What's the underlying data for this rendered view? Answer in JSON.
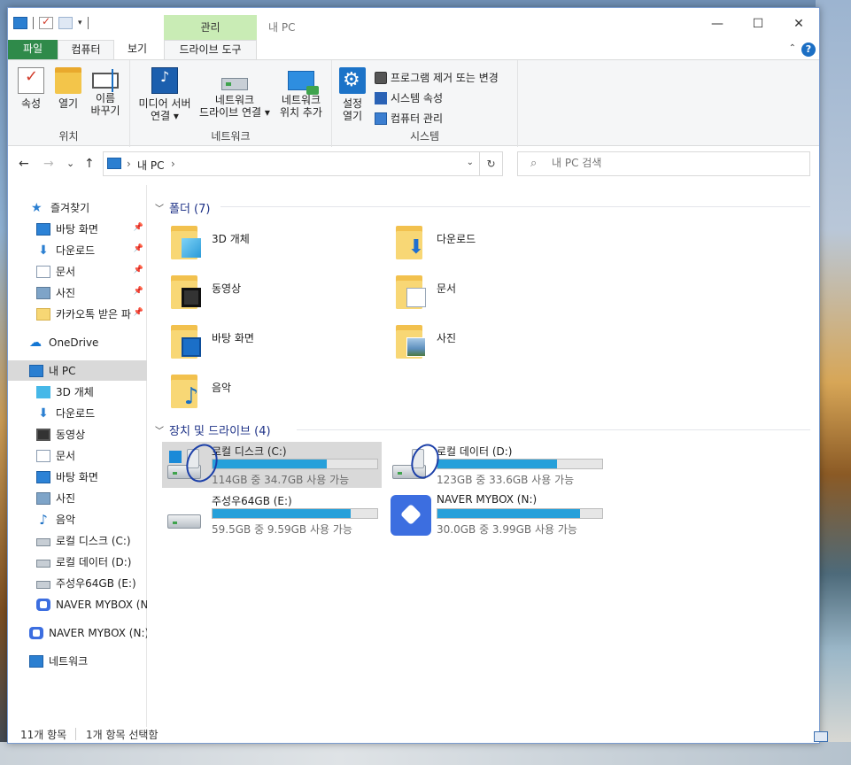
{
  "window": {
    "title": "내 PC",
    "contextual_tab": "관리",
    "controls": {
      "minimize": "—",
      "maximize": "☐",
      "close": "✕"
    }
  },
  "tabs": {
    "file": "파일",
    "computer": "컴퓨터",
    "view": "보기",
    "drive_tools": "드라이브 도구",
    "collapse": "⌃",
    "help": "?"
  },
  "ribbon": {
    "location": {
      "title": "위치",
      "properties": "속성",
      "open": "열기",
      "rename": "이름\n바꾸기"
    },
    "network": {
      "title": "네트워크",
      "media_server": "미디어 서버\n연결 ▾",
      "network_drive": "네트워크\n드라이브 연결 ▾",
      "network_location": "네트워크\n위치 추가"
    },
    "system": {
      "title": "시스템",
      "settings": "설정\n열기",
      "uninstall": "프로그램 제거 또는 변경",
      "sys_props": "시스템 속성",
      "manage": "컴퓨터 관리"
    }
  },
  "nav": {
    "back": "←",
    "forward": "→",
    "recent": "⌄",
    "up": "↑",
    "breadcrumb": [
      "내 PC"
    ],
    "crumb_sep": "›",
    "dropdown": "⌄",
    "refresh": "↻",
    "search_placeholder": "내 PC 검색",
    "search_icon": "⌕"
  },
  "navpane": {
    "quick_access": "즐겨찾기",
    "quick_items": [
      {
        "label": "바탕 화면",
        "icon": "desktop-icon",
        "pinned": true
      },
      {
        "label": "다운로드",
        "icon": "download-icon",
        "pinned": true
      },
      {
        "label": "문서",
        "icon": "document-icon",
        "pinned": true
      },
      {
        "label": "사진",
        "icon": "picture-icon",
        "pinned": true
      },
      {
        "label": "카카오톡 받은 파",
        "icon": "folder-icon",
        "pinned": true
      }
    ],
    "onedrive": "OneDrive",
    "this_pc": "내 PC",
    "pc_items": [
      {
        "label": "3D 개체",
        "icon": "3d-objects-icon"
      },
      {
        "label": "다운로드",
        "icon": "download-icon"
      },
      {
        "label": "동영상",
        "icon": "video-icon"
      },
      {
        "label": "문서",
        "icon": "document-icon"
      },
      {
        "label": "바탕 화면",
        "icon": "desktop-icon"
      },
      {
        "label": "사진",
        "icon": "picture-icon"
      },
      {
        "label": "음악",
        "icon": "music-icon"
      },
      {
        "label": "로컬 디스크 (C:)",
        "icon": "drive-icon"
      },
      {
        "label": "로컬 데이터 (D:)",
        "icon": "drive-icon"
      },
      {
        "label": "주성우64GB (E:)",
        "icon": "usb-drive-icon"
      },
      {
        "label": "NAVER MYBOX (N:)",
        "icon": "mybox-icon"
      }
    ],
    "mybox": "NAVER MYBOX (N:)",
    "network": "네트워크",
    "pin_glyph": "📌"
  },
  "content": {
    "folders_header": "폴더 (7)",
    "folders": [
      {
        "name": "3D 개체",
        "icon": "3d-objects-icon"
      },
      {
        "name": "다운로드",
        "icon": "download-icon"
      },
      {
        "name": "동영상",
        "icon": "video-icon"
      },
      {
        "name": "문서",
        "icon": "document-icon"
      },
      {
        "name": "바탕 화면",
        "icon": "desktop-icon"
      },
      {
        "name": "사진",
        "icon": "picture-icon"
      },
      {
        "name": "음악",
        "icon": "music-icon"
      }
    ],
    "drives_header": "장치 및 드라이브 (4)",
    "drives": [
      {
        "name": "로컬 디스크 (C:)",
        "free": "114GB 중 34.7GB 사용 가능",
        "used_fraction": 0.696,
        "selected": true
      },
      {
        "name": "로컬 데이터 (D:)",
        "free": "123GB 중 33.6GB 사용 가능",
        "used_fraction": 0.727,
        "selected": false
      },
      {
        "name": "주성우64GB (E:)",
        "free": "59.5GB 중 9.59GB 사용 가능",
        "used_fraction": 0.839,
        "selected": false
      },
      {
        "name": "NAVER MYBOX (N:)",
        "free": "30.0GB 중 3.99GB 사용 가능",
        "used_fraction": 0.867,
        "selected": false
      }
    ]
  },
  "status": {
    "count": "11개 항목",
    "selected": "1개 항목 선택함"
  },
  "colors": {
    "accent": "#26a0da",
    "file_tab": "#2f8a4a",
    "manage_tab": "#c9ecb5",
    "section_header": "#1e3287",
    "selection": "#d9d9d9"
  }
}
